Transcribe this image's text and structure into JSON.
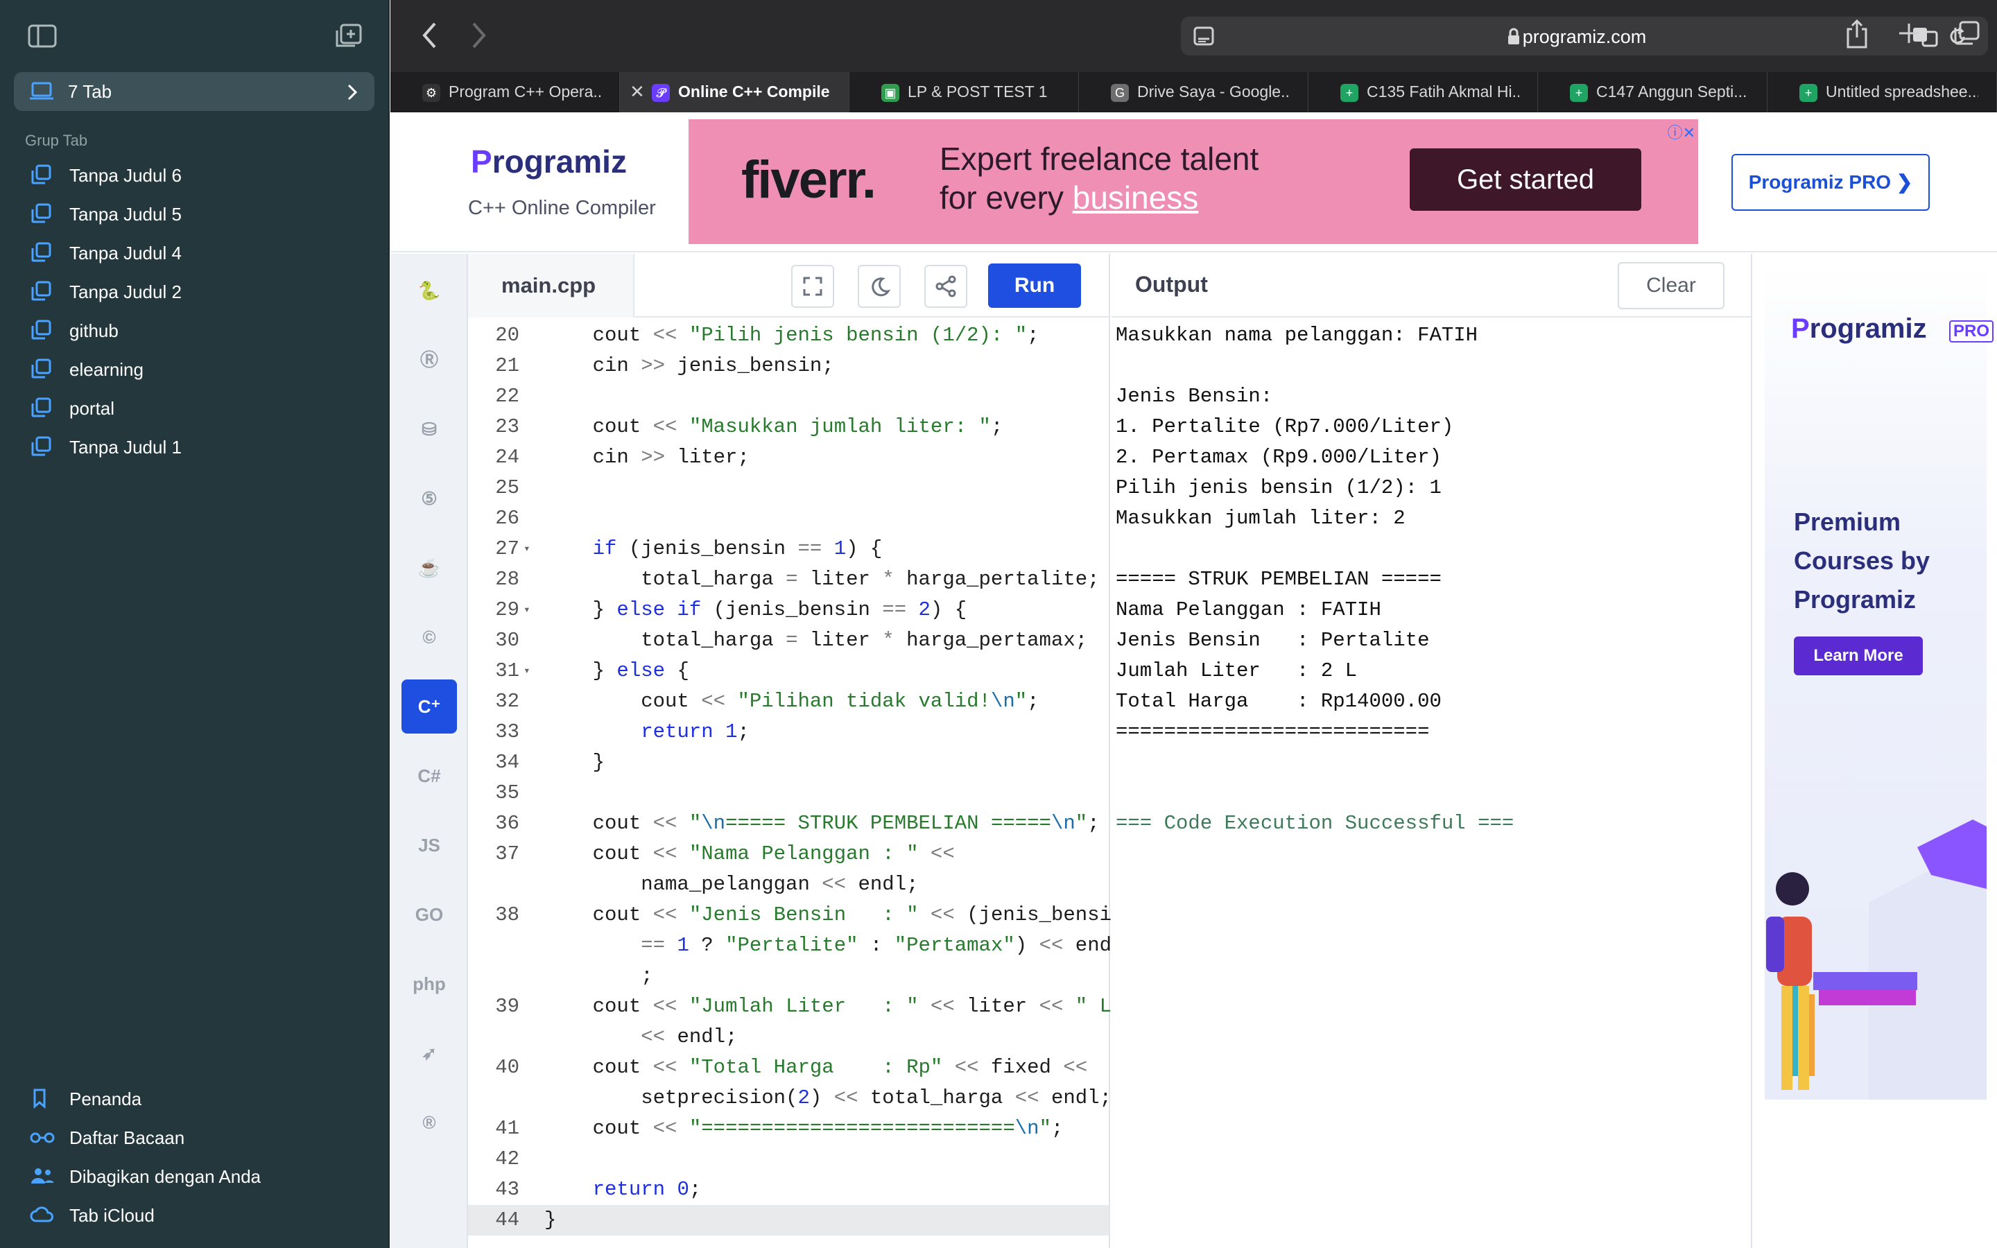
{
  "sidebar": {
    "current_tab_group": "7 Tab",
    "group_heading": "Grup Tab",
    "groups": [
      {
        "label": "Tanpa Judul 6"
      },
      {
        "label": "Tanpa Judul 5"
      },
      {
        "label": "Tanpa Judul 4"
      },
      {
        "label": "Tanpa Judul 2"
      },
      {
        "label": "github"
      },
      {
        "label": "elearning"
      },
      {
        "label": "portal"
      },
      {
        "label": "Tanpa Judul 1"
      }
    ],
    "bottom_items": [
      {
        "label": "Penanda",
        "icon": "bookmark-icon"
      },
      {
        "label": "Daftar Bacaan",
        "icon": "glasses-icon"
      },
      {
        "label": "Dibagikan dengan Anda",
        "icon": "people-icon"
      },
      {
        "label": "Tab iCloud",
        "icon": "cloud-icon"
      }
    ]
  },
  "browser": {
    "url": "programiz.com",
    "tabs": [
      {
        "title": "Program C++ Opera...",
        "active": false
      },
      {
        "title": "Online C++ Compile...",
        "active": true
      },
      {
        "title": "LP & POST TEST 1",
        "active": false
      },
      {
        "title": "Drive Saya - Google...",
        "active": false
      },
      {
        "title": "C135 Fatih Akmal Hi...",
        "active": false
      },
      {
        "title": "C147 Anggun Septi...",
        "active": false
      },
      {
        "title": "Untitled spreadshee...",
        "active": false
      }
    ]
  },
  "header": {
    "logo": "rogramiz",
    "logo_initial": "P",
    "subtitle": "C++ Online Compiler",
    "pro_button": "Programiz PRO ❯"
  },
  "ad": {
    "brand": "fiverr.",
    "tagline_1": "Expert freelance talent",
    "tagline_2_prefix": "for every ",
    "tagline_2_link": "business",
    "cta": "Get started",
    "choices": "ⓘ✕"
  },
  "languages": [
    "Python",
    "R",
    "SQL",
    "HTML",
    "Java",
    "C",
    "C++",
    "C#",
    "JS",
    "GO",
    "php",
    "Swift",
    "Rust"
  ],
  "editor": {
    "filename": "main.cpp",
    "run_label": "Run",
    "lines": [
      {
        "n": "20",
        "html": "    cout <span class=\"op\">&lt;&lt;</span> <span class=\"str\">\"Pilih jenis bensin (1/2): \"</span>;"
      },
      {
        "n": "21",
        "html": "    cin <span class=\"op\">&gt;&gt;</span> jenis_bensin;"
      },
      {
        "n": "22",
        "html": ""
      },
      {
        "n": "23",
        "html": "    cout <span class=\"op\">&lt;&lt;</span> <span class=\"str\">\"Masukkan jumlah liter: \"</span>;"
      },
      {
        "n": "24",
        "html": "    cin <span class=\"op\">&gt;&gt;</span> liter;"
      },
      {
        "n": "25",
        "html": ""
      },
      {
        "n": "26",
        "html": ""
      },
      {
        "n": "27",
        "fold": true,
        "html": "    <span class=\"kw\">if</span> (jenis_bensin <span class=\"op\">==</span> <span class=\"num\">1</span>) {"
      },
      {
        "n": "28",
        "html": "        total_harga <span class=\"op\">=</span> liter <span class=\"op\">*</span> harga_pertalite;"
      },
      {
        "n": "29",
        "fold": true,
        "html": "    } <span class=\"kw\">else if</span> (jenis_bensin <span class=\"op\">==</span> <span class=\"num\">2</span>) {"
      },
      {
        "n": "30",
        "html": "        total_harga <span class=\"op\">=</span> liter <span class=\"op\">*</span> harga_pertamax;"
      },
      {
        "n": "31",
        "fold": true,
        "html": "    } <span class=\"kw\">else</span> {"
      },
      {
        "n": "32",
        "html": "        cout <span class=\"op\">&lt;&lt;</span> <span class=\"str\">\"Pilihan tidak valid!<span class=\"esc\">\\n</span>\"</span>;"
      },
      {
        "n": "33",
        "html": "        <span class=\"kw\">return</span> <span class=\"num\">1</span>;"
      },
      {
        "n": "34",
        "html": "    }"
      },
      {
        "n": "35",
        "html": ""
      },
      {
        "n": "36",
        "html": "    cout <span class=\"op\">&lt;&lt;</span> <span class=\"str\">\"<span class=\"esc\">\\n</span>===== STRUK PEMBELIAN =====<span class=\"esc\">\\n</span>\"</span>;"
      },
      {
        "n": "37",
        "html": "    cout <span class=\"op\">&lt;&lt;</span> <span class=\"str\">\"Nama Pelanggan : \"</span> <span class=\"op\">&lt;&lt;</span>"
      },
      {
        "n": "",
        "html": "        nama_pelanggan <span class=\"op\">&lt;&lt;</span> endl;"
      },
      {
        "n": "38",
        "html": "    cout <span class=\"op\">&lt;&lt;</span> <span class=\"str\">\"Jenis Bensin   : \"</span> <span class=\"op\">&lt;&lt;</span> (jenis_bensin"
      },
      {
        "n": "",
        "html": "        <span class=\"op\">==</span> <span class=\"num\">1</span> ? <span class=\"str\">\"Pertalite\"</span> : <span class=\"str\">\"Pertamax\"</span>) <span class=\"op\">&lt;&lt;</span> endl"
      },
      {
        "n": "",
        "html": "        ;"
      },
      {
        "n": "39",
        "html": "    cout <span class=\"op\">&lt;&lt;</span> <span class=\"str\">\"Jumlah Liter   : \"</span> <span class=\"op\">&lt;&lt;</span> liter <span class=\"op\">&lt;&lt;</span> <span class=\"str\">\" L\"</span>"
      },
      {
        "n": "",
        "html": "        <span class=\"op\">&lt;&lt;</span> endl;"
      },
      {
        "n": "40",
        "html": "    cout <span class=\"op\">&lt;&lt;</span> <span class=\"str\">\"Total Harga    : Rp\"</span> <span class=\"op\">&lt;&lt;</span> fixed <span class=\"op\">&lt;&lt;</span>"
      },
      {
        "n": "",
        "html": "        setprecision(<span class=\"num\">2</span>) <span class=\"op\">&lt;&lt;</span> total_harga <span class=\"op\">&lt;&lt;</span> endl;"
      },
      {
        "n": "41",
        "html": "    cout <span class=\"op\">&lt;&lt;</span> <span class=\"str\">\"==========================<span class=\"esc\">\\n</span>\"</span>;"
      },
      {
        "n": "42",
        "html": ""
      },
      {
        "n": "43",
        "html": "    <span class=\"kw\">return</span> <span class=\"num\">0</span>;"
      },
      {
        "n": "44",
        "cur": true,
        "html": "}"
      }
    ]
  },
  "output": {
    "title": "Output",
    "clear_label": "Clear",
    "lines": [
      "Masukkan nama pelanggan: FATIH",
      "",
      "Jenis Bensin:",
      "1. Pertalite (Rp7.000/Liter)",
      "2. Pertamax (Rp9.000/Liter)",
      "Pilih jenis bensin (1/2): 1",
      "Masukkan jumlah liter: 2",
      "",
      "===== STRUK PEMBELIAN =====",
      "Nama Pelanggan : FATIH",
      "Jenis Bensin   : Pertalite",
      "Jumlah Liter   : 2 L",
      "Total Harga    : Rp14000.00",
      "==========================",
      "",
      "",
      "=== Code Execution Successful ==="
    ]
  },
  "side_ad": {
    "logo": "rogramiz",
    "logo_initial": "P",
    "badge": "PRO",
    "line1": "Premium",
    "line2": "Courses by",
    "line3": "Programiz",
    "button": "Learn More"
  },
  "colors": {
    "sidebar_bg": "#24373c",
    "accent": "#1f4fe0",
    "ad_bg": "#f08fb4"
  }
}
